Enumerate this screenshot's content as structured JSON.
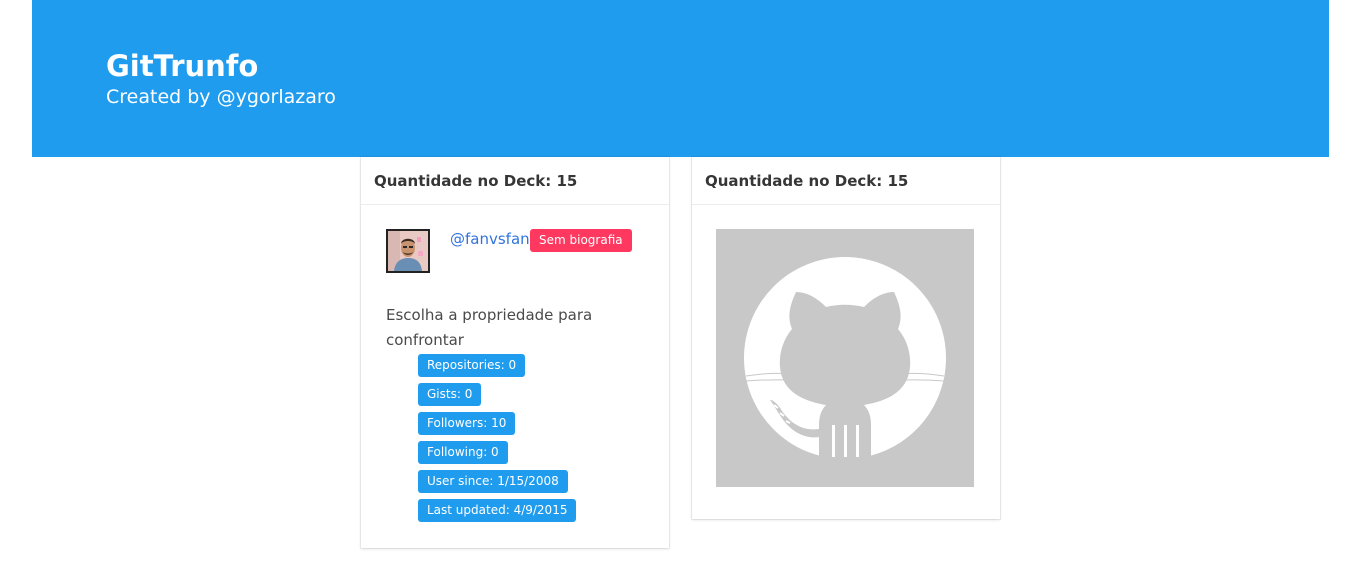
{
  "header": {
    "title": "GitTrunfo",
    "subtitle": "Created by @ygorlazaro",
    "background_color": "#209cee"
  },
  "player_card": {
    "deck_label": "Quantidade no Deck: 15",
    "username": "@fanvsfan",
    "bio_tag": "Sem biografia",
    "prompt": "Escolha a propriedade para confrontar",
    "stats": [
      "Repositories: 0",
      "Gists: 0",
      "Followers: 10",
      "Following: 0",
      "User since: 1/15/2008",
      "Last updated: 4/9/2015"
    ],
    "avatar_icon": "user-avatar-photo"
  },
  "opponent_card": {
    "deck_label": "Quantidade no Deck: 15",
    "image_icon": "github-octocat-icon"
  },
  "colors": {
    "primary": "#209cee",
    "danger": "#ff3860",
    "link": "#3273dc"
  }
}
